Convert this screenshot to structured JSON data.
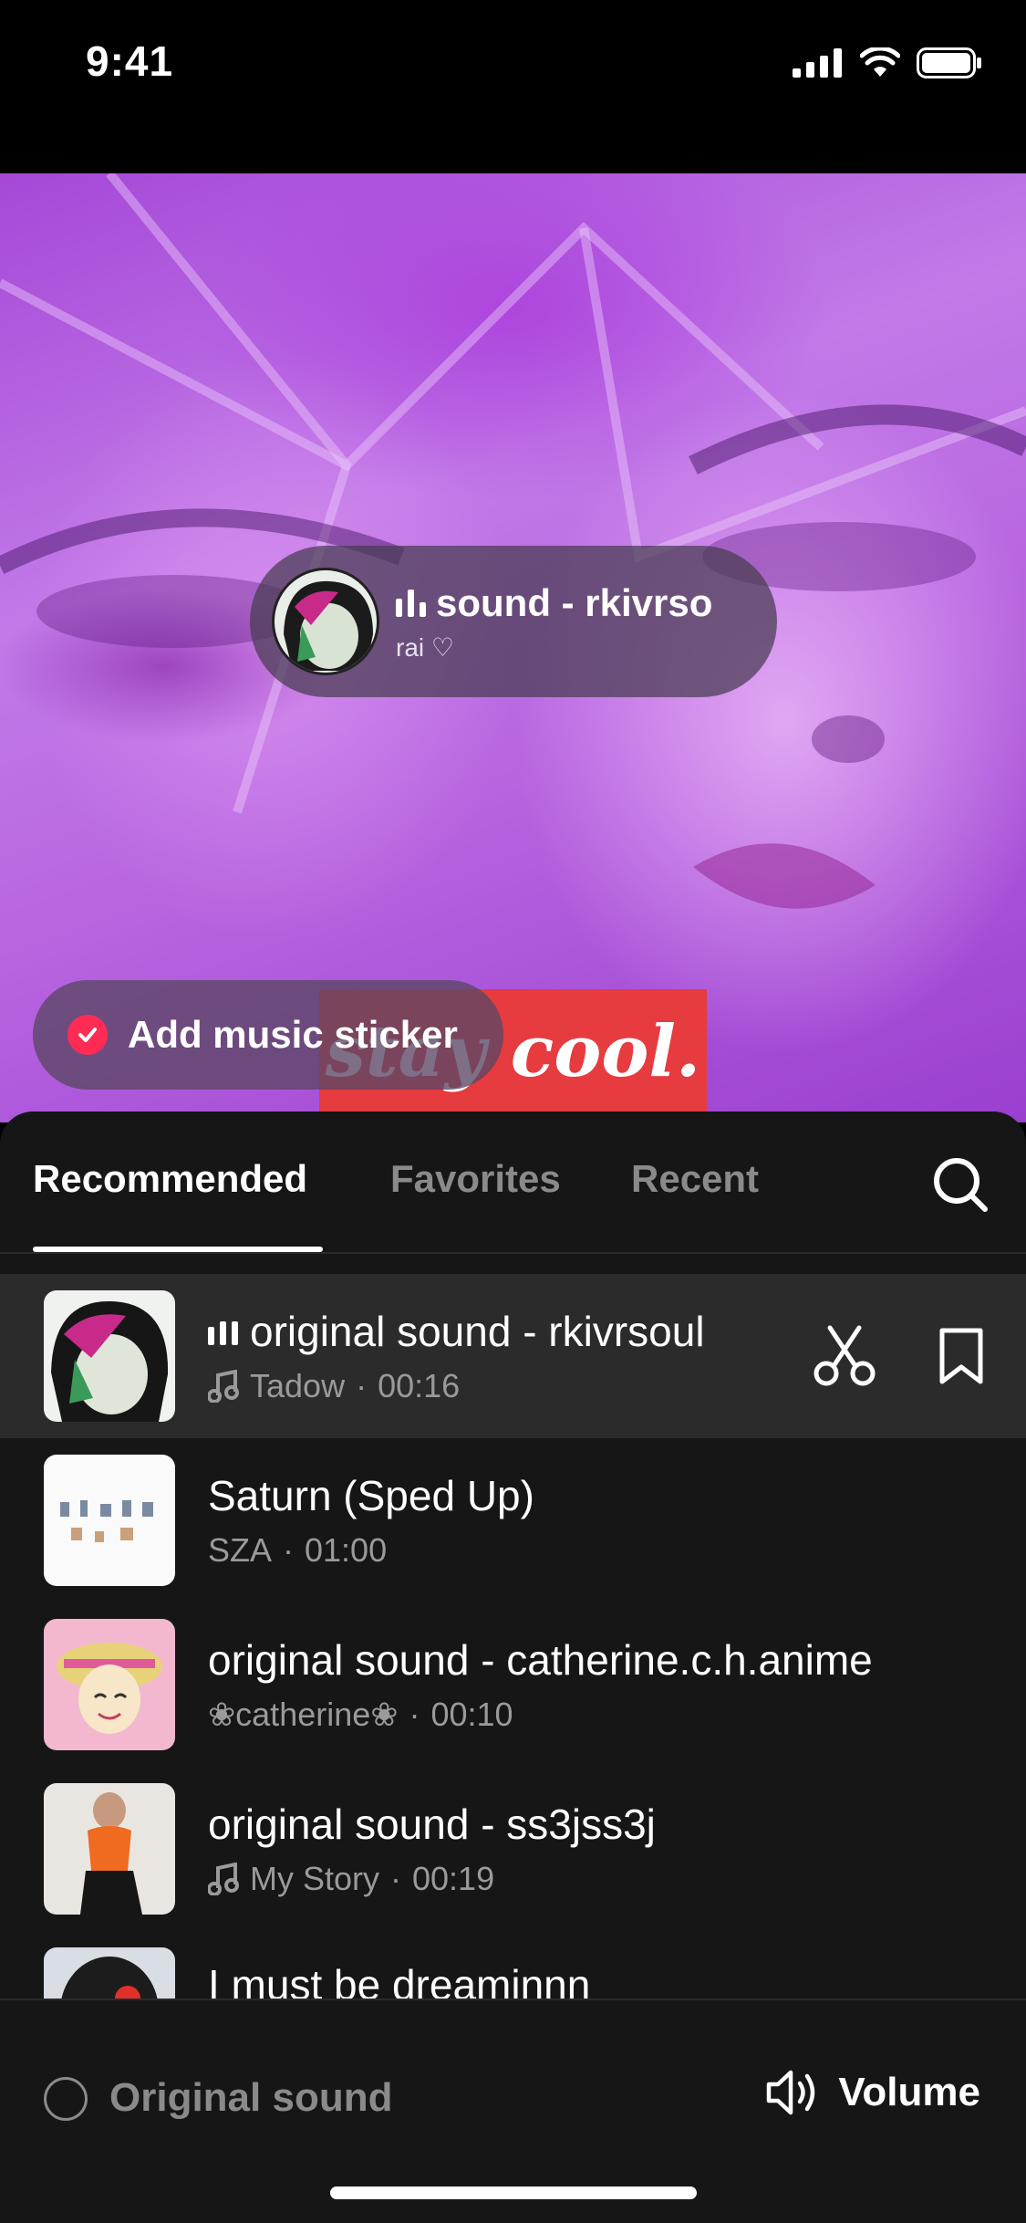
{
  "status_bar": {
    "time": "9:41"
  },
  "sticker": {
    "title": "sound - rkivrso",
    "subtitle": "rai ♡"
  },
  "add_sticker": {
    "label": "Add music sticker",
    "checked": true
  },
  "stay_cool": {
    "text": "stay cool."
  },
  "tabs": [
    {
      "label": "Recommended",
      "active": true
    },
    {
      "label": "Favorites",
      "active": false
    },
    {
      "label": "Recent",
      "active": false
    }
  ],
  "tracks": [
    {
      "title": "original sound - rkivrsoul",
      "artist": "Tadow",
      "duration": "00:16",
      "playing": true,
      "note_icon": true
    },
    {
      "title": "Saturn (Sped Up)",
      "artist": "SZA",
      "duration": "01:00",
      "playing": false,
      "note_icon": false
    },
    {
      "title": "original sound - catherine.c.h.anime",
      "artist": "❀catherine❀",
      "duration": "00:10",
      "playing": false,
      "note_icon": false
    },
    {
      "title": "original sound - ss3jss3j",
      "artist": "My Story",
      "duration": "00:19",
      "playing": false,
      "note_icon": true
    },
    {
      "title": "I must be dreaminnn",
      "artist": "",
      "duration": "",
      "playing": false,
      "note_icon": false
    }
  ],
  "footer": {
    "original_sound_label": "Original sound",
    "volume_label": "Volume"
  },
  "colors": {
    "accent": "#fe2c55",
    "sheet_bg": "#161616",
    "selected_row": "#2b2b2b",
    "stay_cool_red": "#e63b3f"
  }
}
